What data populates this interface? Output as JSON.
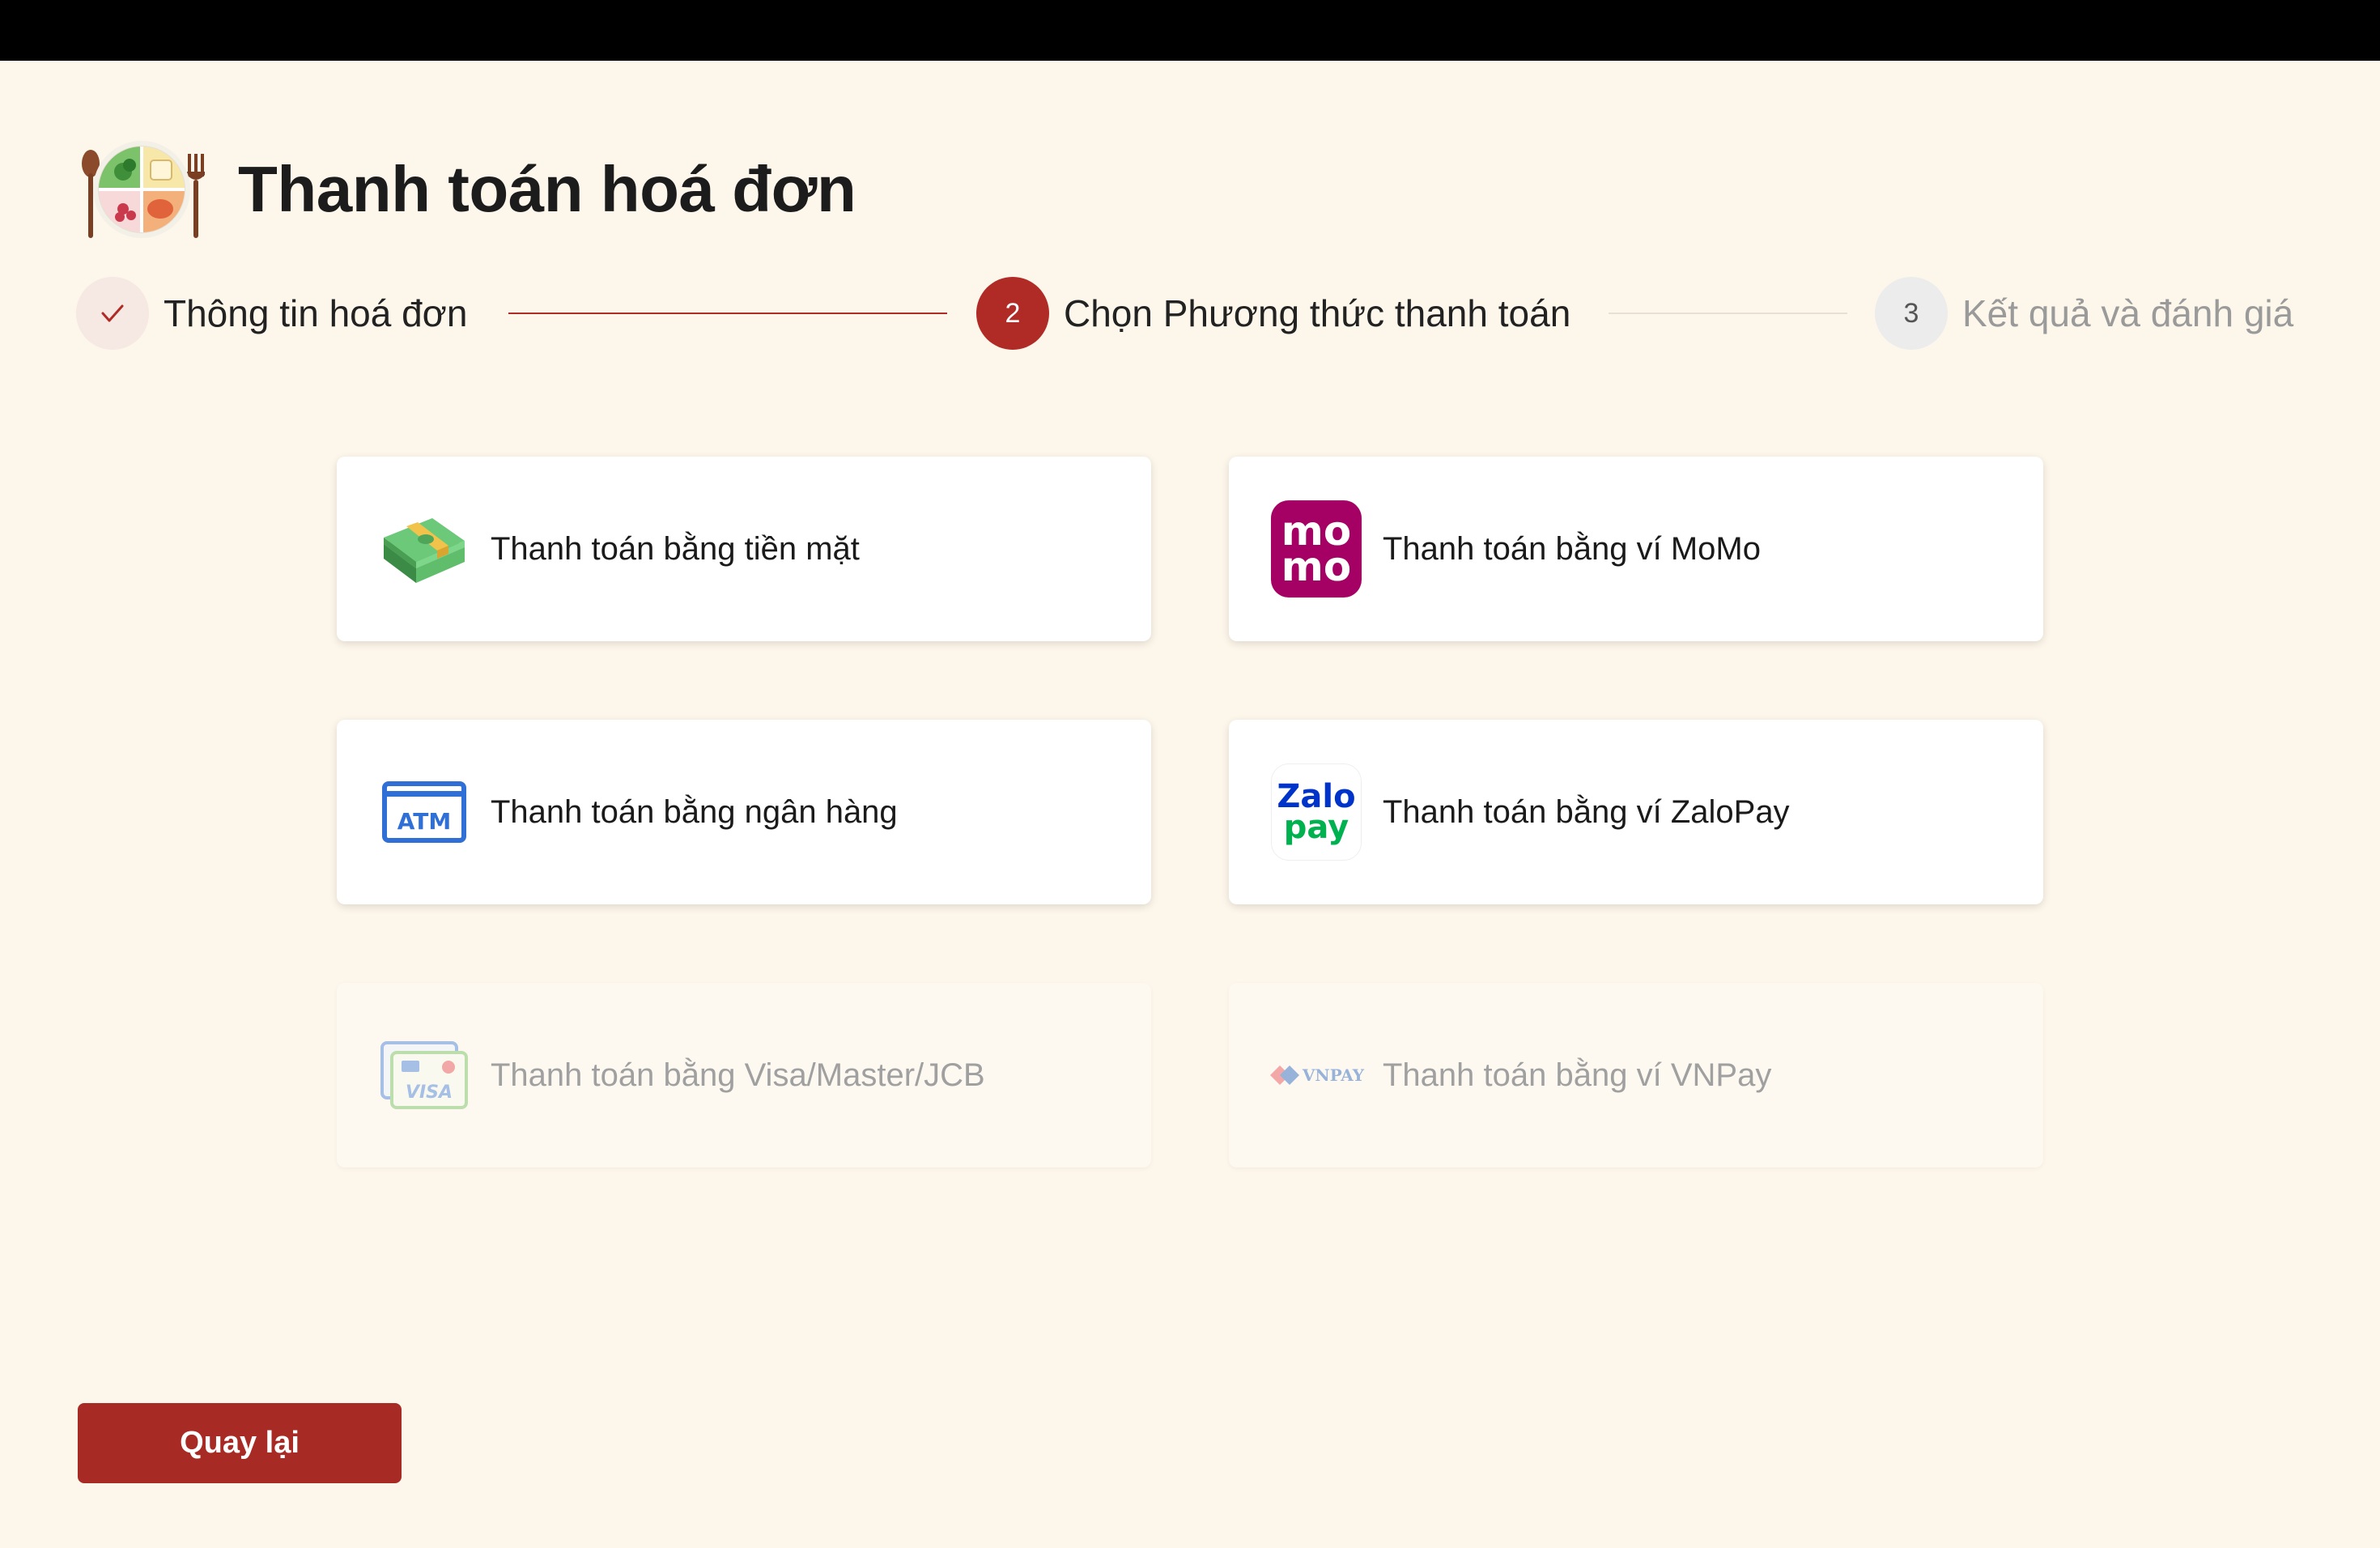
{
  "header": {
    "title": "Thanh toán hoá đơn",
    "logo_icon": "food-plate-icon"
  },
  "stepper": {
    "steps": [
      {
        "number": "",
        "label": "Thông tin hoá đơn",
        "state": "completed",
        "icon": "check-icon"
      },
      {
        "number": "2",
        "label": "Chọn Phương thức thanh toán",
        "state": "active"
      },
      {
        "number": "3",
        "label": "Kết quả và đánh giá",
        "state": "pending"
      }
    ],
    "colors": {
      "active": "#b02a26",
      "completed_bg": "#f6e8e3",
      "pending_bg": "#ececec"
    }
  },
  "payment_methods": [
    {
      "label": "Thanh toán bằng tiền mặt",
      "icon": "cash-icon",
      "enabled": true
    },
    {
      "label": "Thanh toán bằng ví MoMo",
      "icon": "momo-icon",
      "icon_text_top": "mo",
      "icon_text_bottom": "mo",
      "enabled": true
    },
    {
      "label": "Thanh toán bằng ngân hàng",
      "icon": "atm-card-icon",
      "icon_text": "ATM",
      "enabled": true
    },
    {
      "label": "Thanh toán bằng ví ZaloPay",
      "icon": "zalopay-icon",
      "icon_text_top": "Zalo",
      "icon_text_bottom": "pay",
      "enabled": true
    },
    {
      "label": "Thanh toán bằng Visa/Master/JCB",
      "icon": "visa-card-icon",
      "icon_text": "VISA",
      "enabled": false
    },
    {
      "label": "Thanh toán bằng ví VNPay",
      "icon": "vnpay-icon",
      "icon_text": "VNPAY",
      "enabled": false
    }
  ],
  "actions": {
    "back_label": "Quay lại"
  },
  "colors": {
    "background": "#fdf6ea",
    "primary": "#a82a24",
    "momo": "#a50064",
    "zalo_blue": "#0033c9",
    "zalo_green": "#00b14f"
  }
}
